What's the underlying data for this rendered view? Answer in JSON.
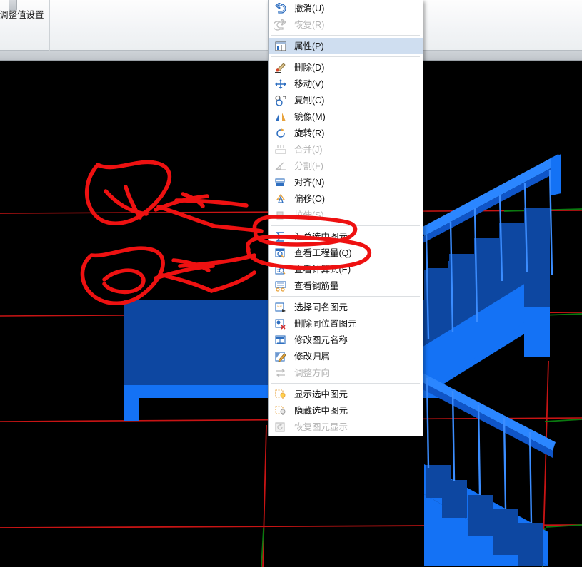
{
  "window": {
    "panel_label": "调整值设置",
    "grip_icon": "drag-grip-icon"
  },
  "context_menu": {
    "groups": [
      {
        "items": [
          {
            "label": "撤消(U)",
            "icon": "undo-arrow-icon",
            "disabled": false,
            "selected": false
          },
          {
            "label": "恢复(R)",
            "icon": "redo-arrow-icon",
            "disabled": true,
            "selected": false
          }
        ]
      },
      {
        "items": [
          {
            "label": "属性(P)",
            "icon": "properties-panel-icon",
            "disabled": false,
            "selected": true
          }
        ]
      },
      {
        "items": [
          {
            "label": "删除(D)",
            "icon": "delete-brush-icon",
            "disabled": false,
            "selected": false
          },
          {
            "label": "移动(V)",
            "icon": "move-cross-icon",
            "disabled": false,
            "selected": false
          },
          {
            "label": "复制(C)",
            "icon": "copy-icon",
            "disabled": false,
            "selected": false
          },
          {
            "label": "镜像(M)",
            "icon": "mirror-icon",
            "disabled": false,
            "selected": false
          },
          {
            "label": "旋转(R)",
            "icon": "rotate-icon",
            "disabled": false,
            "selected": false
          },
          {
            "label": "合并(J)",
            "icon": "merge-icon",
            "disabled": true,
            "selected": false
          },
          {
            "label": "分割(F)",
            "icon": "split-icon",
            "disabled": true,
            "selected": false
          },
          {
            "label": "对齐(N)",
            "icon": "align-icon",
            "disabled": false,
            "selected": false
          },
          {
            "label": "偏移(O)",
            "icon": "offset-icon",
            "disabled": false,
            "selected": false
          },
          {
            "label": "拉伸(S)",
            "icon": "stretch-icon",
            "disabled": true,
            "selected": false
          }
        ]
      },
      {
        "items": [
          {
            "label": "汇总选中图元",
            "icon": "sigma-sum-icon",
            "disabled": false,
            "selected": false
          },
          {
            "label": "查看工程量(Q)",
            "icon": "view-quantity-icon",
            "disabled": false,
            "selected": false
          },
          {
            "label": "查看计算式(E)",
            "icon": "view-formula-icon",
            "disabled": false,
            "selected": false
          },
          {
            "label": "查看钢筋量",
            "icon": "view-rebar-icon",
            "disabled": false,
            "selected": false
          }
        ]
      },
      {
        "items": [
          {
            "label": "选择同名图元",
            "icon": "select-same-name-icon",
            "disabled": false,
            "selected": false
          },
          {
            "label": "删除同位置图元",
            "icon": "delete-same-position-icon",
            "disabled": false,
            "selected": false
          },
          {
            "label": "修改图元名称",
            "icon": "rename-element-icon",
            "disabled": false,
            "selected": false
          },
          {
            "label": "修改归属",
            "icon": "change-owner-icon",
            "disabled": false,
            "selected": false
          },
          {
            "label": "调整方向",
            "icon": "adjust-direction-icon",
            "disabled": true,
            "selected": false
          }
        ]
      },
      {
        "items": [
          {
            "label": "显示选中图元",
            "icon": "show-selected-icon",
            "disabled": false,
            "selected": false
          },
          {
            "label": "隐藏选中图元",
            "icon": "hide-selected-icon",
            "disabled": false,
            "selected": false
          },
          {
            "label": "恢复图元显示",
            "icon": "restore-display-icon",
            "disabled": true,
            "selected": false
          }
        ]
      }
    ]
  },
  "viewport": {
    "background": "#000000",
    "model_name": "stair-3d-model",
    "colors": {
      "stair_dark_blue": "#0d47a1",
      "stair_bright_blue": "#1472f5",
      "railing_blue": "#1b75f0",
      "axis_red": "#d01010",
      "axis_green": "#0a7a10",
      "annotation_red": "#ee1111"
    }
  },
  "annotations": {
    "marks": [
      {
        "name": "circle-mark-upper-left",
        "shape": "lasso-circle"
      },
      {
        "name": "arrow-upper-to-menu",
        "shape": "arrow"
      },
      {
        "name": "circle-mark-lower-left",
        "shape": "lasso-circle"
      },
      {
        "name": "arrow-lower-to-menu",
        "shape": "arrow"
      },
      {
        "name": "circle-around-sum-selected-item",
        "shape": "circle"
      },
      {
        "name": "circle-around-view-quantity-item",
        "shape": "circle"
      }
    ]
  }
}
